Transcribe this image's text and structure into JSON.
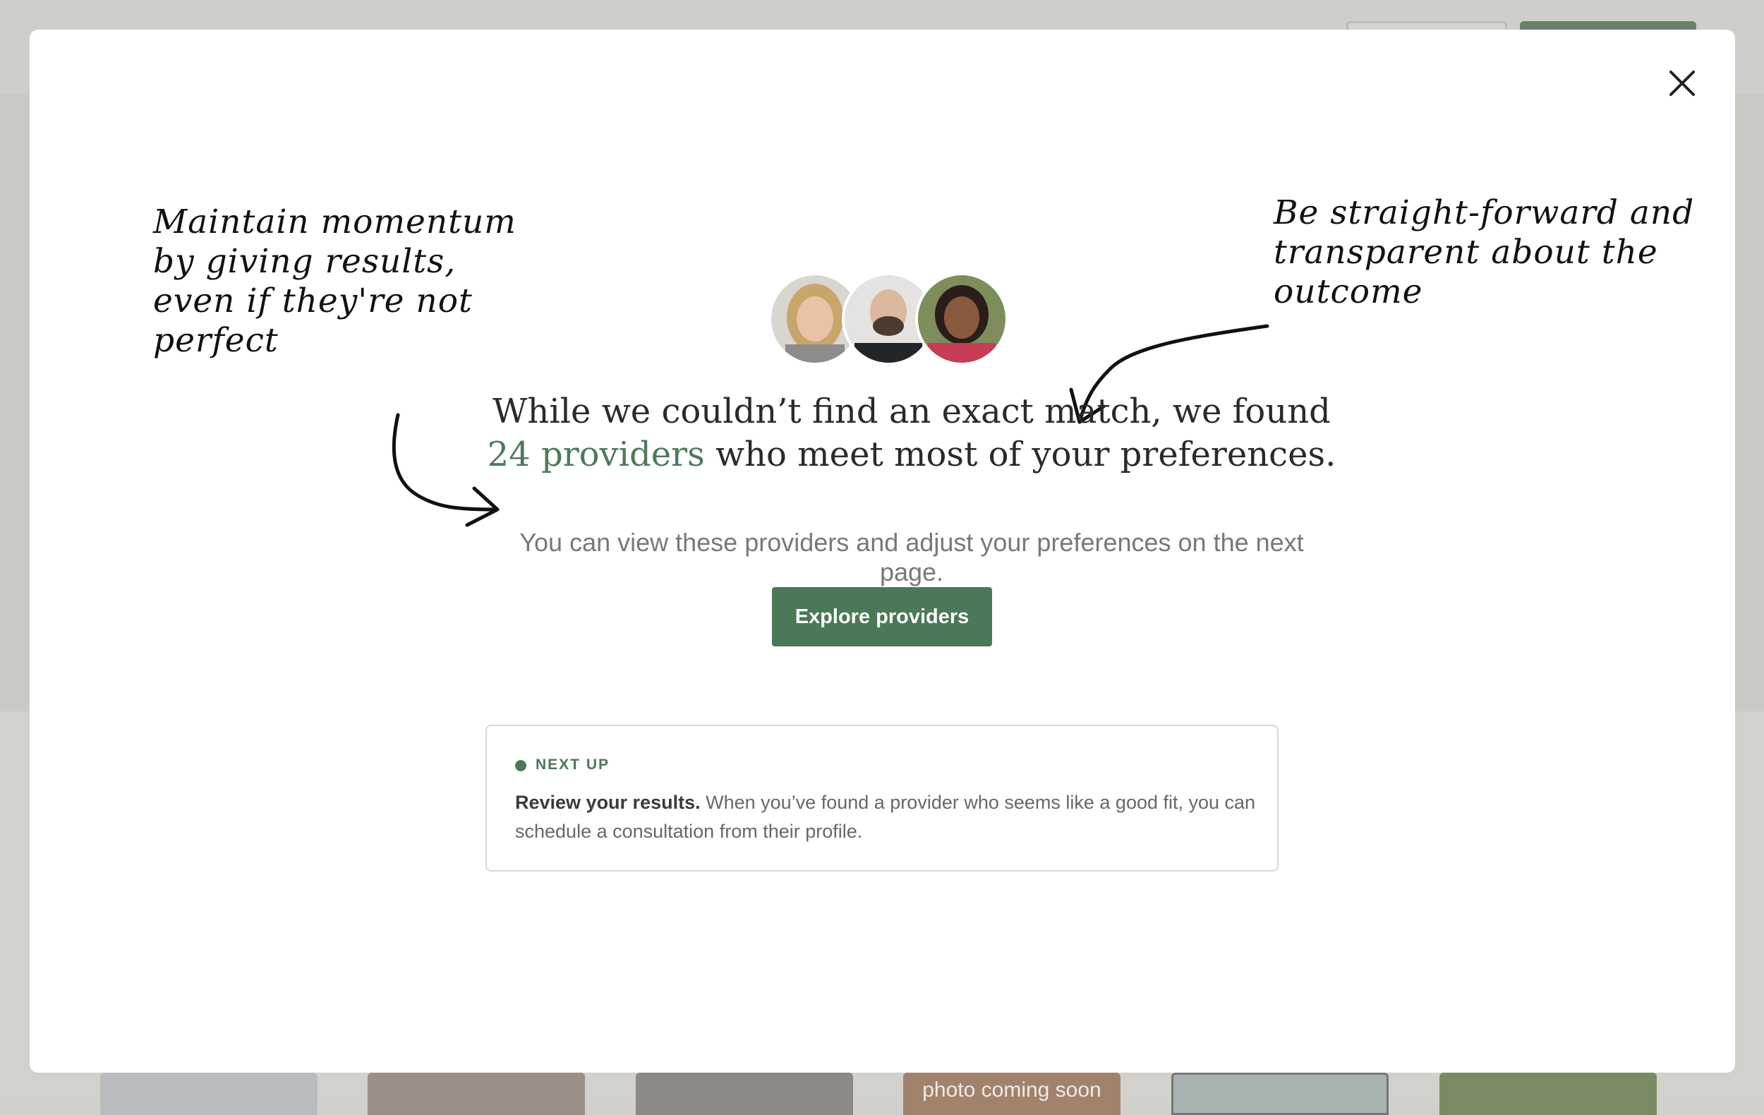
{
  "background": {
    "cards": [
      {
        "label": ""
      },
      {
        "label": ""
      },
      {
        "label": ""
      },
      {
        "label": "photo coming soon"
      },
      {
        "label": ""
      },
      {
        "label": ""
      }
    ]
  },
  "modal": {
    "close_icon": "close-icon",
    "annotations": {
      "left": "Maintain momentum by giving results, even if they're not perfect",
      "right": "Be straight-forward and transparent about the outcome"
    },
    "headline_part1": "While we couldn’t find an exact match, we found",
    "headline_accent": "24 providers",
    "headline_part2": "who meet most of your preferences.",
    "subtext": "You can view these providers and adjust your preferences on the next page.",
    "cta_label": "Explore providers",
    "next_up": {
      "label": "NEXT UP",
      "title": "Review your results.",
      "text": "When you’ve found a provider who seems like a good fit, you can schedule a consultation from their profile."
    }
  },
  "colors": {
    "accent": "#4b7857",
    "accent_text": "#4d7a5a",
    "overlay": "#d2d0cb"
  }
}
